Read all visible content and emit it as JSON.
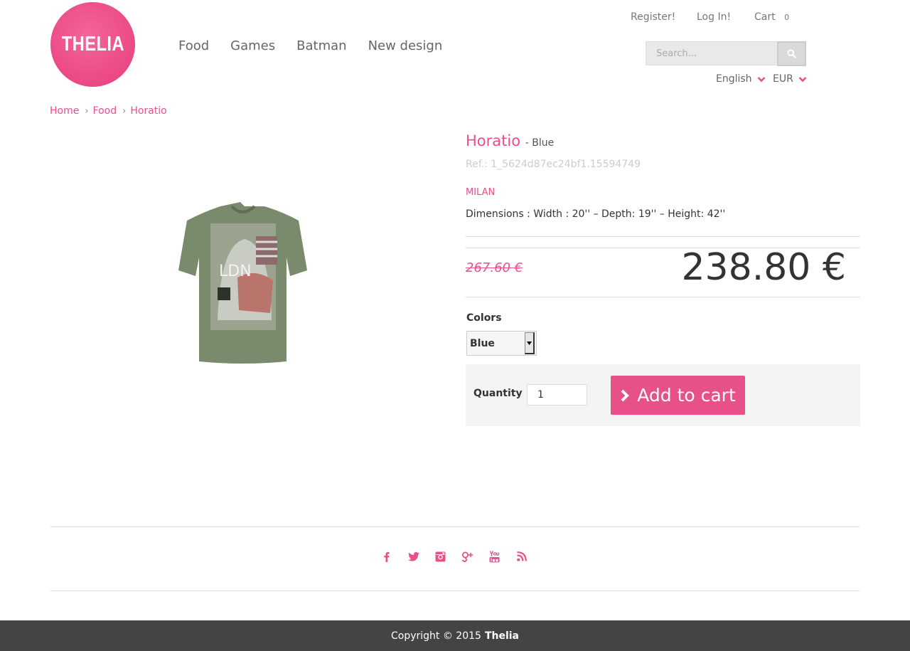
{
  "brand": {
    "logo_text": "THELIA"
  },
  "nav": {
    "items": [
      "Food",
      "Games",
      "Batman",
      "New design"
    ]
  },
  "header": {
    "register": "Register!",
    "login": "Log In!",
    "cart_label": "Cart",
    "cart_count": "0",
    "search_placeholder": "Search...",
    "language": "English",
    "currency": "EUR"
  },
  "breadcrumb": [
    "Home",
    "Food",
    "Horatio"
  ],
  "product": {
    "name": "Horatio",
    "variant": "- Blue",
    "ref": "Ref.: 1_5624d87ec24bf1.15594749",
    "brand": "MILAN",
    "description": "Dimensions : Width : 20'' – Depth: 19'' – Height: 42''",
    "old_price": "267.60 €",
    "price": "238.80 €",
    "colors_label": "Colors",
    "color_selected": "Blue",
    "quantity_label": "Quantity",
    "quantity": "1",
    "add_to_cart": "Add to cart",
    "image_text": "LDN"
  },
  "footer": {
    "social_icons": [
      "facebook-icon",
      "twitter-icon",
      "instagram-icon",
      "google-plus-icon",
      "youtube-icon",
      "rss-icon"
    ],
    "copyright_prefix": "Copyright © 2015",
    "copyright_brand": "Thelia"
  },
  "colors": {
    "accent": "#e8508a",
    "footer_bg": "#444444"
  }
}
